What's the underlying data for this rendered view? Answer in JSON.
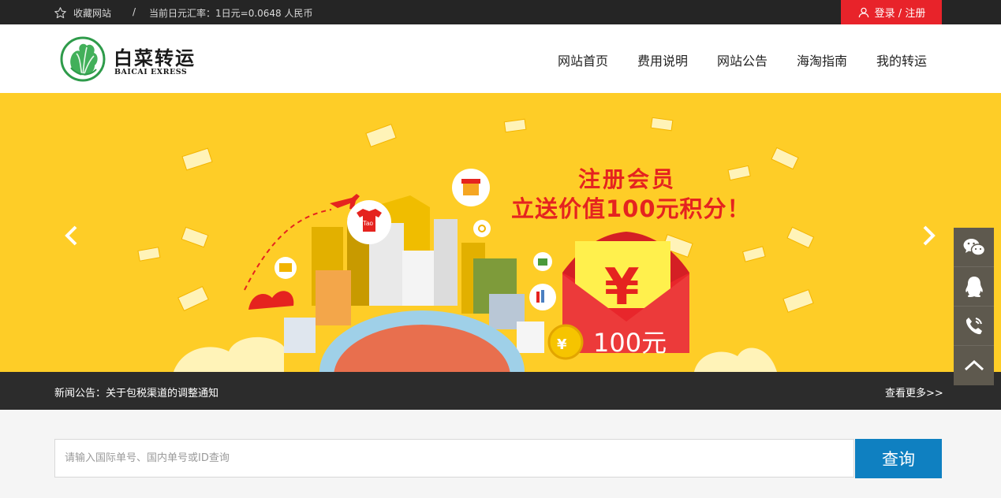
{
  "topbar": {
    "favorite_label": "收藏网站",
    "separator": "/",
    "exchange_rate": "当前日元汇率：1日元=0.0648 人民币",
    "login_label": "登录 / 注册"
  },
  "logo": {
    "name": "白菜转运",
    "subtitle": "BAICAI EXRESS"
  },
  "nav": {
    "items": [
      {
        "label": "网站首页"
      },
      {
        "label": "费用说明"
      },
      {
        "label": "网站公告"
      },
      {
        "label": "海淘指南"
      },
      {
        "label": "我的转运"
      }
    ]
  },
  "banner": {
    "headline_1": "注册会员",
    "headline_2": "立送价值100元积分！",
    "envelope_amount": "100元",
    "coin_tag": "¥100",
    "shirt_tag": "Tao",
    "colors": {
      "background": "#fecd27",
      "accent": "#e5231f"
    }
  },
  "news": {
    "text": "新闻公告：关于包税渠道的调整通知",
    "more_label": "查看更多>>"
  },
  "search": {
    "placeholder": "请输入国际单号、国内单号或ID查询",
    "value": "",
    "button_label": "查询"
  },
  "side_tools": [
    {
      "icon": "wechat-icon"
    },
    {
      "icon": "qq-icon"
    },
    {
      "icon": "phone-icon"
    },
    {
      "icon": "back-to-top-icon"
    }
  ]
}
